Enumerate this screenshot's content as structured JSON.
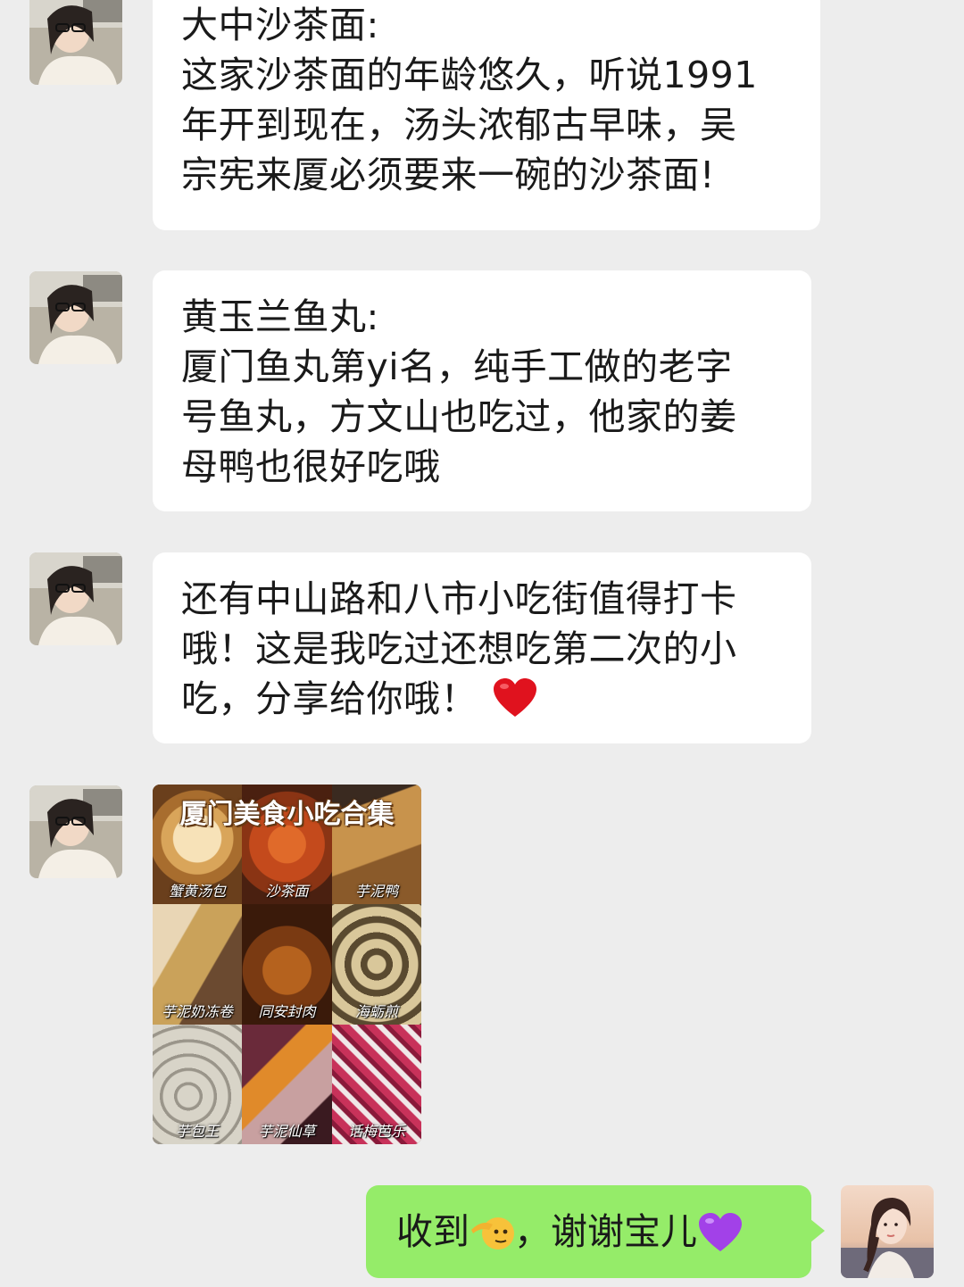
{
  "messages": [
    {
      "sender": "contact",
      "type": "text",
      "lines": [
        "大中沙茶面:",
        "这家沙茶面的年龄悠久，听说1991",
        "年开到现在，汤头浓郁古早味，吴",
        "宗宪来厦必须要来一碗的沙茶面!"
      ]
    },
    {
      "sender": "contact",
      "type": "text",
      "lines": [
        "黄玉兰鱼丸:",
        "厦门鱼丸第yi名，纯手工做的老字",
        "号鱼丸，方文山也吃过，他家的姜",
        "母鸭也很好吃哦"
      ]
    },
    {
      "sender": "contact",
      "type": "text",
      "lines": [
        "还有中山路和八市小吃街值得打卡",
        "哦！这是我吃过还想吃第二次的小",
        "吃，分享给你哦！"
      ],
      "trailing_emoji": "red-heart"
    },
    {
      "sender": "contact",
      "type": "image",
      "image_title": "厦门美食小吃合集",
      "image_labels": [
        "蟹黄汤包",
        "沙茶面",
        "芋泥鸭",
        "芋泥奶冻卷",
        "同安封肉",
        "海蛎煎",
        "芋包王",
        "芋泥仙草",
        "话梅芭乐"
      ]
    },
    {
      "sender": "me",
      "type": "text",
      "text_before": "收到",
      "emoji": "saluting-face",
      "text_after": "，谢谢宝儿",
      "trailing_emoji": "purple-heart"
    }
  ],
  "colors": {
    "background": "#ededed",
    "incoming_bubble": "#ffffff",
    "outgoing_bubble": "#95ec69",
    "text": "#1a1a1a"
  }
}
